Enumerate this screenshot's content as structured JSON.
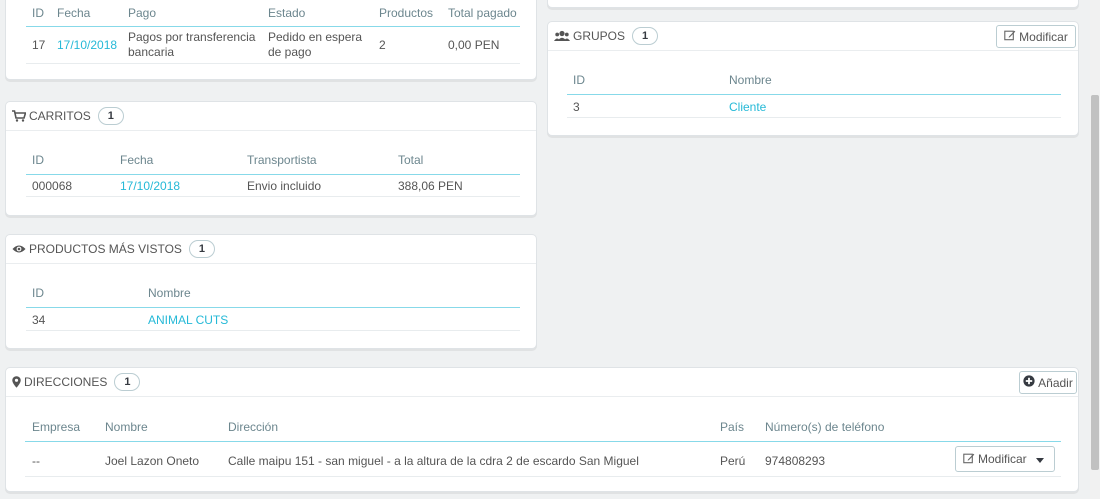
{
  "orders": {
    "headers": [
      "ID",
      "Fecha",
      "Pago",
      "Estado",
      "Productos",
      "Total pagado"
    ],
    "row": {
      "id": "17",
      "date": "17/10/2018",
      "payment_line1": "Pagos por transferencia",
      "payment_line2": "bancaria",
      "status_line1": "Pedido en espera",
      "status_line2": "de pago",
      "products": "2",
      "total": "0,00 PEN"
    }
  },
  "groups": {
    "title": "GRUPOS",
    "count": "1",
    "edit_label": "Modificar",
    "headers": [
      "ID",
      "Nombre"
    ],
    "rows": [
      {
        "id": "3",
        "name": "Cliente"
      }
    ]
  },
  "carts": {
    "title": "CARRITOS",
    "count": "1",
    "headers": [
      "ID",
      "Fecha",
      "Transportista",
      "Total"
    ],
    "rows": [
      {
        "id": "000068",
        "date": "17/10/2018",
        "carrier": "Envio incluido",
        "total": "388,06 PEN"
      }
    ]
  },
  "viewed": {
    "title": "PRODUCTOS MÁS VISTOS",
    "count": "1",
    "headers": [
      "ID",
      "Nombre"
    ],
    "rows": [
      {
        "id": "34",
        "name": "ANIMAL CUTS"
      }
    ]
  },
  "addresses": {
    "title": "DIRECCIONES",
    "count": "1",
    "add_label": "Añadir",
    "headers": [
      "Empresa",
      "Nombre",
      "Dirección",
      "País",
      "Número(s) de teléfono"
    ],
    "rows": [
      {
        "company": "--",
        "name": "Joel Lazon Oneto",
        "address": "Calle maipu 151 - san miguel - a la altura de la cdra 2 de escardo San Miguel",
        "country": "Perú",
        "phone": "974808293",
        "edit_label": "Modificar"
      }
    ]
  },
  "icons": [
    "users-icon",
    "cart-icon",
    "eye-icon",
    "map-marker-icon",
    "edit-icon",
    "plus-circle-icon",
    "caret-down-icon"
  ],
  "colors": {
    "link": "#25b9d7",
    "background": "#eff1f2"
  }
}
